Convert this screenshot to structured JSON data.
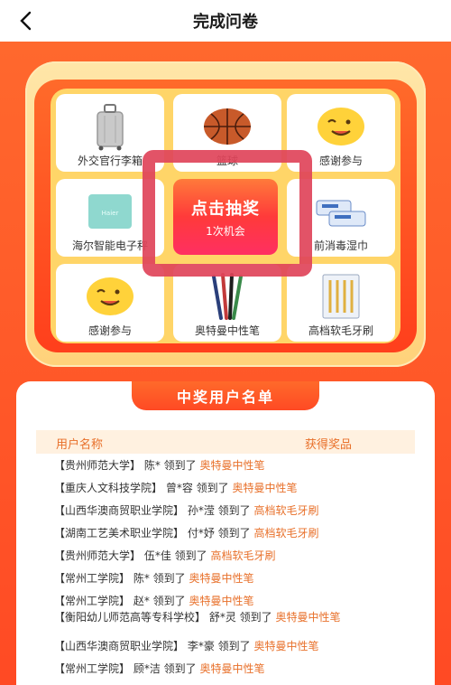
{
  "header": {
    "title": "完成问卷"
  },
  "lottery": {
    "prizes": [
      {
        "name": "外交官行李箱",
        "icon": "suitcase-icon"
      },
      {
        "name": "篮球",
        "icon": "basketball-icon"
      },
      {
        "name": "感谢参与",
        "icon": "smiley-icon"
      },
      {
        "name": "海尔智能电子秤",
        "icon": "scale-icon"
      },
      {
        "name": "前消毒湿巾",
        "icon": "wipes-icon"
      },
      {
        "name": "感谢参与",
        "icon": "smiley-icon"
      },
      {
        "name": "奥特曼中性笔",
        "icon": "pen-icon"
      },
      {
        "name": "高档软毛牙刷",
        "icon": "toothbrush-icon"
      }
    ],
    "draw_button": {
      "label": "点击抽奖",
      "chance": "1次机会"
    }
  },
  "winners": {
    "title": "中奖用户名单",
    "col_user": "用户名称",
    "col_prize": "获得奖品",
    "rows": [
      {
        "user": "【贵州师范大学】 陈*",
        "verb": "领到了",
        "prize": "奥特曼中性笔"
      },
      {
        "user": "【重庆人文科技学院】 曾*容",
        "verb": "领到了",
        "prize": "奥特曼中性笔"
      },
      {
        "user": "【山西华澳商贸职业学院】 孙*滢",
        "verb": "领到了",
        "prize": "高档软毛牙刷"
      },
      {
        "user": "【湖南工艺美术职业学院】 付*妤",
        "verb": "领到了",
        "prize": "高档软毛牙刷"
      },
      {
        "user": "【贵州师范大学】 伍*佳",
        "verb": "领到了",
        "prize": "高档软毛牙刷"
      },
      {
        "user": "【常州工学院】 陈*",
        "verb": "领到了",
        "prize": "奥特曼中性笔"
      },
      {
        "user": "【常州工学院】 赵*",
        "verb": "领到了",
        "prize": "奥特曼中性笔"
      },
      {
        "user": "【衡阳幼儿师范高等专科学校】 舒*灵",
        "verb": "领到了",
        "prize": "奥特曼中性笔"
      },
      {
        "user": "【山西华澳商贸职业学院】 李*豪",
        "verb": "领到了",
        "prize": "奥特曼中性笔"
      },
      {
        "user": "【常州工学院】 顾*洁",
        "verb": "领到了",
        "prize": "奥特曼中性笔"
      }
    ]
  },
  "colors": {
    "accent": "#ff4a24",
    "prize_text": "#e8702a",
    "highlight": "#e0445a"
  }
}
